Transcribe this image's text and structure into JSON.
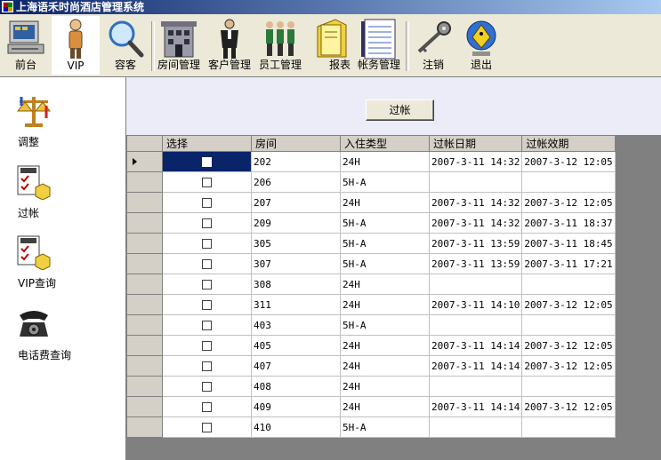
{
  "window": {
    "title": "上海语禾时尚酒店管理系统"
  },
  "toolbar": {
    "items": [
      {
        "label": "前台",
        "icon": "front-desk-computer-icon"
      },
      {
        "label": "VIP",
        "icon": "vip-person-icon"
      },
      {
        "label": "容客",
        "icon": "magnifier-icon"
      },
      {
        "label": "房间管理",
        "icon": "building-icon"
      },
      {
        "label": "客户管理",
        "icon": "customer-person-icon"
      },
      {
        "label": "员工管理",
        "icon": "staff-group-icon"
      },
      {
        "label": "报表",
        "icon": "report-folder-icon"
      },
      {
        "label": "帐务管理",
        "icon": "ledger-notebook-icon"
      },
      {
        "label": "注销",
        "icon": "key-icon"
      },
      {
        "label": "退出",
        "icon": "exit-globe-icon"
      }
    ]
  },
  "sidebar": {
    "items": [
      {
        "label": "调整",
        "icon": "scales-icon"
      },
      {
        "label": "过帐",
        "icon": "sale-checklist-icon"
      },
      {
        "label": "VIP查询",
        "icon": "sale-checklist-icon"
      },
      {
        "label": "电话费查询",
        "icon": "telephone-icon"
      }
    ]
  },
  "main": {
    "post_button_label": "过帐"
  },
  "grid": {
    "headers": [
      "选择",
      "房间",
      "入住类型",
      "过帐日期",
      "过帐效期"
    ],
    "rows": [
      {
        "room": "202",
        "type": "24H",
        "post_date": "2007-3-11 14:32",
        "expire": "2007-3-12 12:05"
      },
      {
        "room": "206",
        "type": "5H-A",
        "post_date": "",
        "expire": ""
      },
      {
        "room": "207",
        "type": "24H",
        "post_date": "2007-3-11 14:32",
        "expire": "2007-3-12 12:05"
      },
      {
        "room": "209",
        "type": "5H-A",
        "post_date": "2007-3-11 14:32",
        "expire": "2007-3-11 18:37"
      },
      {
        "room": "305",
        "type": "5H-A",
        "post_date": "2007-3-11 13:59",
        "expire": "2007-3-11 18:45"
      },
      {
        "room": "307",
        "type": "5H-A",
        "post_date": "2007-3-11 13:59",
        "expire": "2007-3-11 17:21"
      },
      {
        "room": "308",
        "type": "24H",
        "post_date": "",
        "expire": ""
      },
      {
        "room": "311",
        "type": "24H",
        "post_date": "2007-3-11 14:10",
        "expire": "2007-3-12 12:05"
      },
      {
        "room": "403",
        "type": "5H-A",
        "post_date": "",
        "expire": ""
      },
      {
        "room": "405",
        "type": "24H",
        "post_date": "2007-3-11 14:14",
        "expire": "2007-3-12 12:05"
      },
      {
        "room": "407",
        "type": "24H",
        "post_date": "2007-3-11 14:14",
        "expire": "2007-3-12 12:05"
      },
      {
        "room": "408",
        "type": "24H",
        "post_date": "",
        "expire": ""
      },
      {
        "room": "409",
        "type": "24H",
        "post_date": "2007-3-11 14:14",
        "expire": "2007-3-12 12:05"
      },
      {
        "room": "410",
        "type": "5H-A",
        "post_date": "",
        "expire": ""
      }
    ]
  }
}
